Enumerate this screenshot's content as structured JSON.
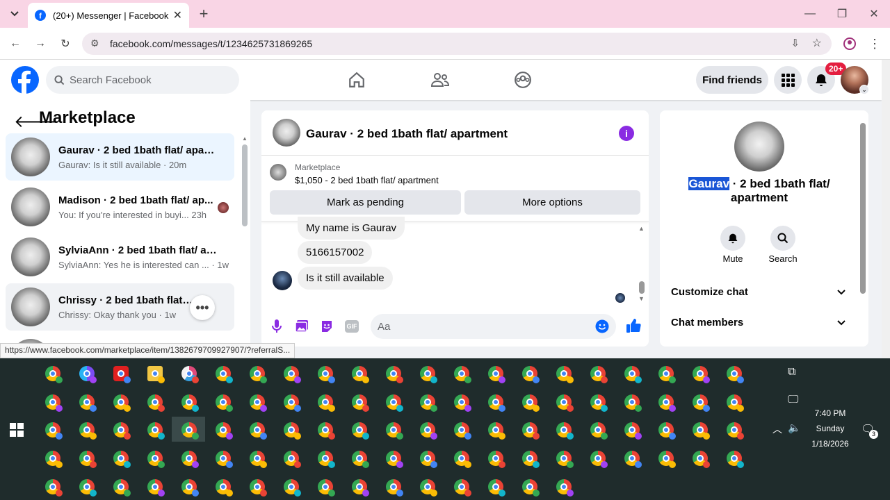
{
  "browser": {
    "tab_title": "(20+) Messenger | Facebook",
    "url": "facebook.com/messages/t/1234625731869265",
    "status_url": "https://www.facebook.com/marketplace/item/1382679709927907/?referralS..."
  },
  "header": {
    "search_placeholder": "Search Facebook",
    "find_friends": "Find friends",
    "notif_count": "20+"
  },
  "left": {
    "title": "Marketplace",
    "conversations": [
      {
        "title": "Gaurav · 2 bed 1bath flat/ apart...",
        "sub": "Gaurav: Is it still available · 20m"
      },
      {
        "title": "Madison · 2 bed 1bath flat/ ap...",
        "sub": "You: If you're interested in buyi...  23h"
      },
      {
        "title": "SylviaAnn · 2 bed 1bath flat/ apa...",
        "sub": "SylviaAnn: Yes he is interested can ... · 1w"
      },
      {
        "title": "Chrissy · 2 bed 1bath flat/ ap...",
        "sub": "Chrissy: Okay thank you · 1w"
      }
    ]
  },
  "chat": {
    "title": "Gaurav · 2 bed 1bath flat/ apartment",
    "listing_source": "Marketplace",
    "listing_price": "$1,050 - 2 bed 1bath flat/ apartment",
    "mark_pending": "Mark as pending",
    "more_options": "More options",
    "messages": [
      "My name is Gaurav",
      "5166157002",
      "Is it still available"
    ],
    "composer_placeholder": "Aa",
    "gif_label": "GIF"
  },
  "details": {
    "name_highlight": "Gaurav",
    "title_rest": " · 2 bed 1bath flat/",
    "title_line2": "apartment",
    "mute_label": "Mute",
    "search_label": "Search",
    "customize_chat": "Customize chat",
    "chat_members": "Chat members"
  },
  "taskbar": {
    "time": "7:40 PM",
    "day": "Sunday",
    "date": "1/18/2026",
    "notif_count": "3"
  },
  "colors": {
    "fb_blue": "#0866ff",
    "accent_purple": "#8a2be2",
    "taskbar_bg": "#1f2c2c"
  }
}
